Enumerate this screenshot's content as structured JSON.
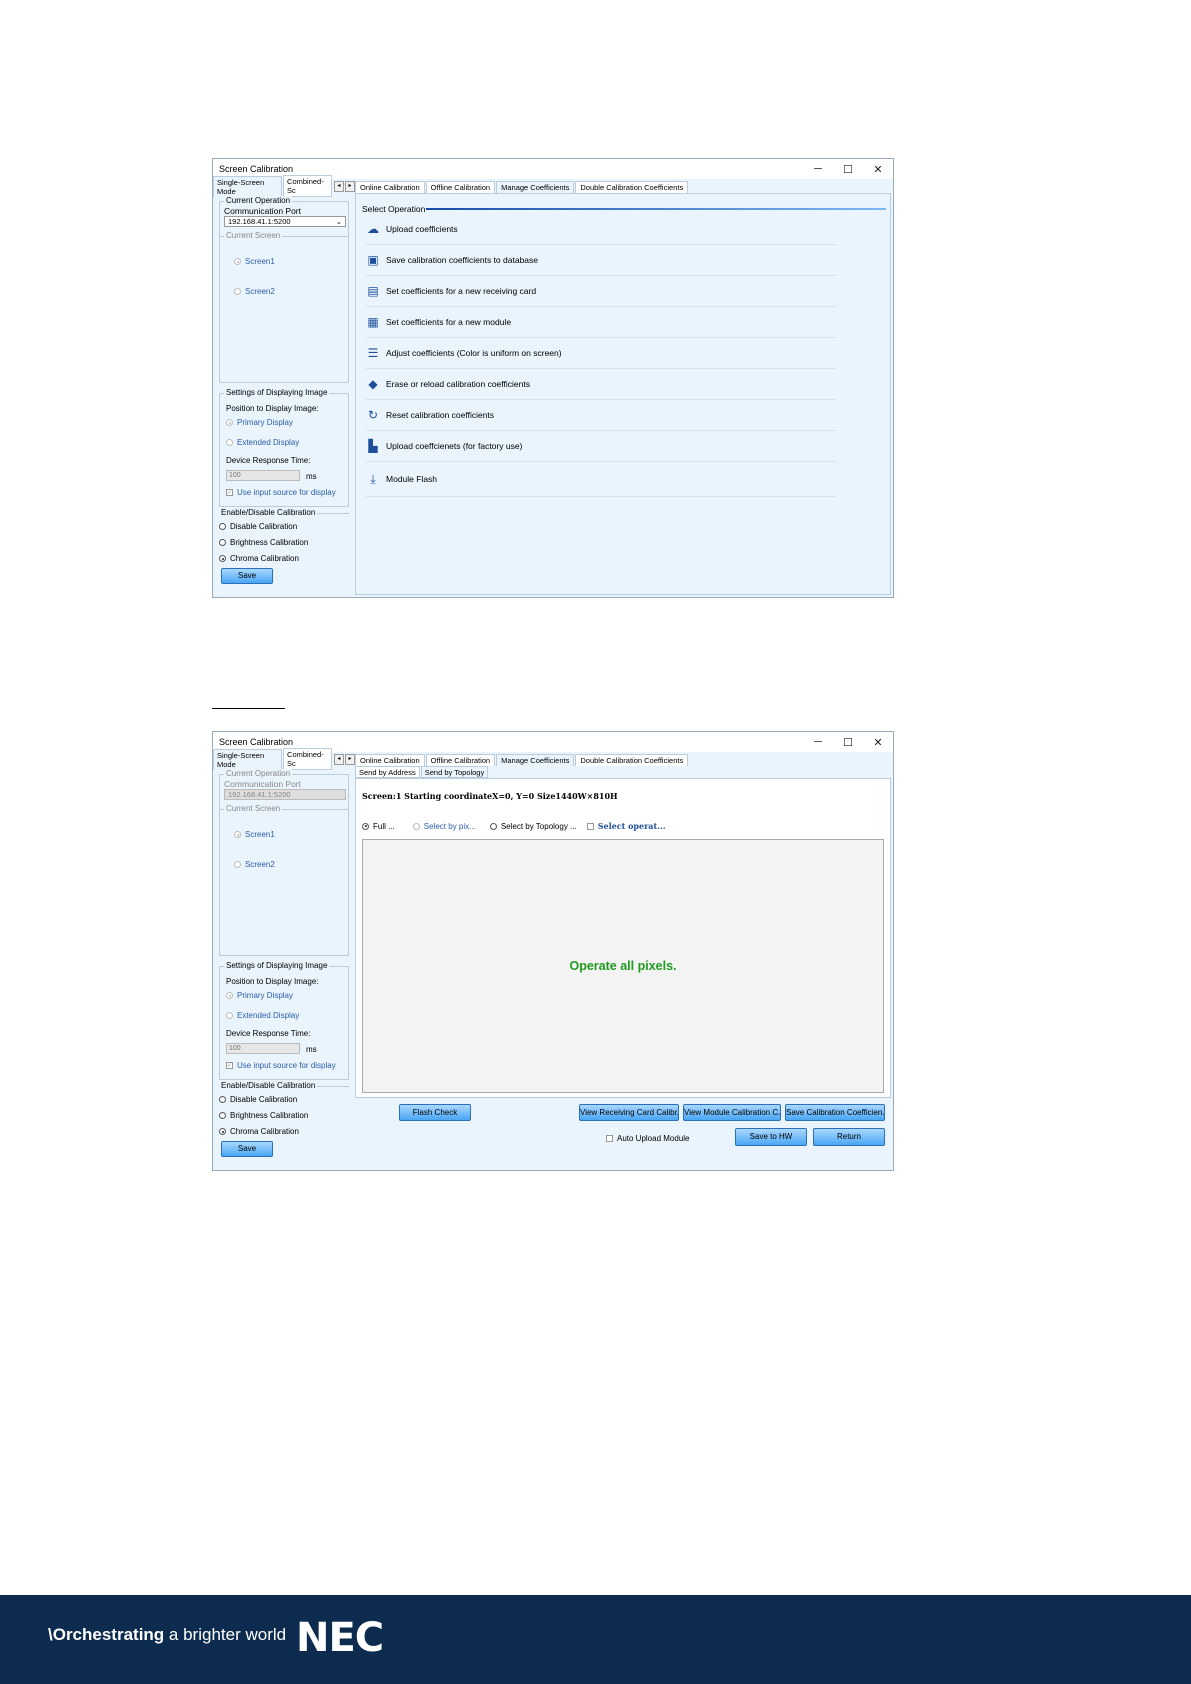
{
  "window_title": "Screen Calibration",
  "window_controls": {
    "minimize": "─",
    "maximize": "☐",
    "close": "✕"
  },
  "left_tabs": [
    "Single-Screen Mode",
    "Combined-Sc"
  ],
  "left_tab_arrows": [
    "◂",
    "▸"
  ],
  "main_tabs": [
    "Online Calibration",
    "Offline Calibration",
    "Manage Coefficients",
    "Double Calibration Coefficients"
  ],
  "left": {
    "current_operation": "Current Operation",
    "communication_port_label": "Communication Port",
    "communication_port_value": "192.168.41.1:5200",
    "current_screen": "Current Screen",
    "screens": [
      "Screen1",
      "Screen2"
    ],
    "settings_title": "Settings of Displaying Image",
    "position_label": "Position to Display Image:",
    "primary_display": "Primary Display",
    "extended_display": "Extended Display",
    "response_label": "Device Response Time:",
    "response_value": "100",
    "response_unit": "ms",
    "use_input_source": "Use input source for display",
    "enable_title": "Enable/Disable Calibration",
    "disable_calibration": "Disable Calibration",
    "brightness_calibration": "Brightness Calibration",
    "chroma_calibration": "Chroma Calibration",
    "save_button": "Save"
  },
  "screenshot1": {
    "select_operation": "Select Operation",
    "operations": [
      {
        "label": "Upload coefficients",
        "icon": "upload-cloud-icon",
        "glyph": "☁"
      },
      {
        "label": "Save calibration coefficients to database",
        "icon": "save-icon",
        "glyph": "▣"
      },
      {
        "label": "Set coefficients for a new receiving card",
        "icon": "receiving-card-icon",
        "glyph": "▤"
      },
      {
        "label": "Set coefficients for a new module",
        "icon": "module-grid-icon",
        "glyph": "▦"
      },
      {
        "label": "Adjust coefficients (Color is uniform on screen)",
        "icon": "sliders-icon",
        "glyph": "☰"
      },
      {
        "label": "Erase or reload calibration coefficients",
        "icon": "eraser-icon",
        "glyph": "◆"
      },
      {
        "label": "Reset calibration coefficients",
        "icon": "reset-icon",
        "glyph": "↻"
      },
      {
        "label": "Upload coeffcienets (for factory use)",
        "icon": "factory-icon",
        "glyph": "▙"
      },
      {
        "label": "Module Flash",
        "icon": "download-icon",
        "glyph": "⤓"
      }
    ]
  },
  "screenshot2": {
    "sub_tabs": [
      "Send by Address",
      "Send by Topology"
    ],
    "info_line": "Screen:1  Starting coordinateX=0, Y=0   Size1440W×810H",
    "option_full": "Full ...",
    "option_pixel": "Select by pix...",
    "option_topology": "Select by Topology ...",
    "option_select_operat": "Select operat...",
    "canvas_message": "Operate all pixels.",
    "flash_check": "Flash Check",
    "view_receiving": "View Receiving Card Calibr...",
    "view_module": "View Module Calibration C...",
    "save_coefficients": "Save Calibration Coefficien...",
    "auto_upload": "Auto Upload Module",
    "save_to_hw": "Save to HW",
    "return": "Return"
  },
  "footer": {
    "tagline_bold": "\\Orchestrating",
    "tagline_rest": " a brighter world",
    "logo": "NEC"
  },
  "colors": {
    "footer_bg": "#0d2b4f",
    "message_green": "#1f9a1f",
    "button_blue": "#4aa6f5"
  }
}
